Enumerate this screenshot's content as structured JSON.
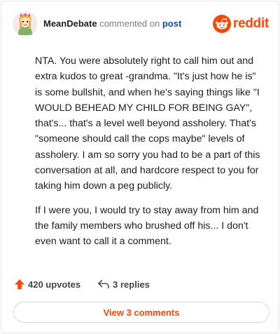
{
  "header": {
    "username": "MeanDebate",
    "action_text": "commented on",
    "post_link": "post",
    "brand_name": "reddit"
  },
  "comment": {
    "paragraphs": [
      "NTA. You were absolutely right to call him out and extra kudos to great -grandma. \"It's just how he is\" is some bullshit, and when he's saying things like \"I WOULD BEHEAD MY CHILD FOR BEING GAY\", that's... that's a level well beyond assholery. That's \"someone should call the cops maybe\" levels of assholery. I am so sorry you had to be a part of this conversation at all, and hardcore respect to you for taking him down a peg publicly.",
      "If I were you, I would try to stay away from him and the family members who brushed off his... I don't even want to call it a comment."
    ]
  },
  "actions": {
    "upvotes": "420 upvotes",
    "replies": "3 replies"
  },
  "footer": {
    "view_comments": "View 3 comments"
  },
  "icons": {
    "avatar": "avatar-image",
    "brand": "reddit-snoo-icon",
    "upvote": "upvote-arrow-icon",
    "reply": "reply-arrow-icon"
  },
  "colors": {
    "brand": "#ff4500",
    "link": "#0b4f9c",
    "muted": "#7c7c7c",
    "border": "#e3e3e3"
  }
}
